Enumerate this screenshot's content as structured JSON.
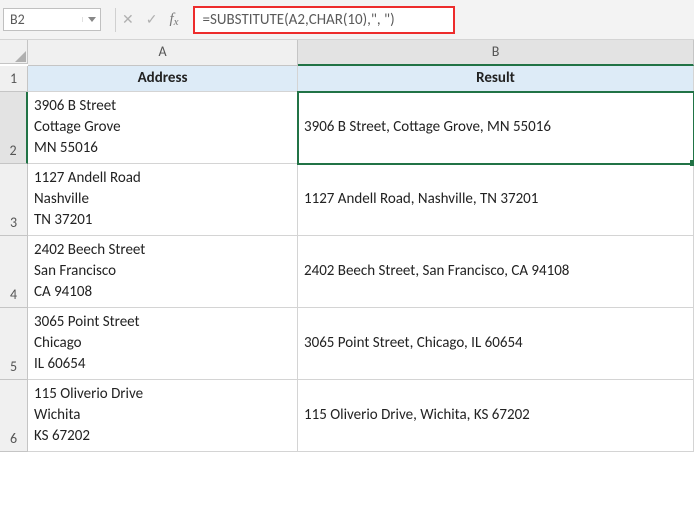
{
  "name_box": "B2",
  "formula": "=SUBSTITUTE(A2,CHAR(10),\", \")",
  "col_labels": {
    "A": "A",
    "B": "B"
  },
  "row_labels": {
    "r1": "1",
    "r2": "2",
    "r3": "3",
    "r4": "4",
    "r5": "5",
    "r6": "6"
  },
  "headers": {
    "A": "Address",
    "B": "Result"
  },
  "rows": [
    {
      "address": "3906 B Street\nCottage Grove\nMN 55016",
      "result": "3906 B Street, Cottage Grove, MN 55016"
    },
    {
      "address": "1127 Andell Road\nNashville\nTN 37201",
      "result": "1127 Andell Road, Nashville, TN 37201"
    },
    {
      "address": "2402 Beech Street\nSan Francisco\nCA 94108",
      "result": "2402 Beech Street, San Francisco, CA 94108"
    },
    {
      "address": "3065 Point Street\nChicago\nIL 60654",
      "result": "3065 Point Street, Chicago, IL 60654"
    },
    {
      "address": "115 Oliverio Drive\nWichita\nKS 67202",
      "result": "115 Oliverio Drive, Wichita, KS 67202"
    }
  ],
  "fx_buttons": {
    "cancel": "✕",
    "confirm": "✓"
  }
}
